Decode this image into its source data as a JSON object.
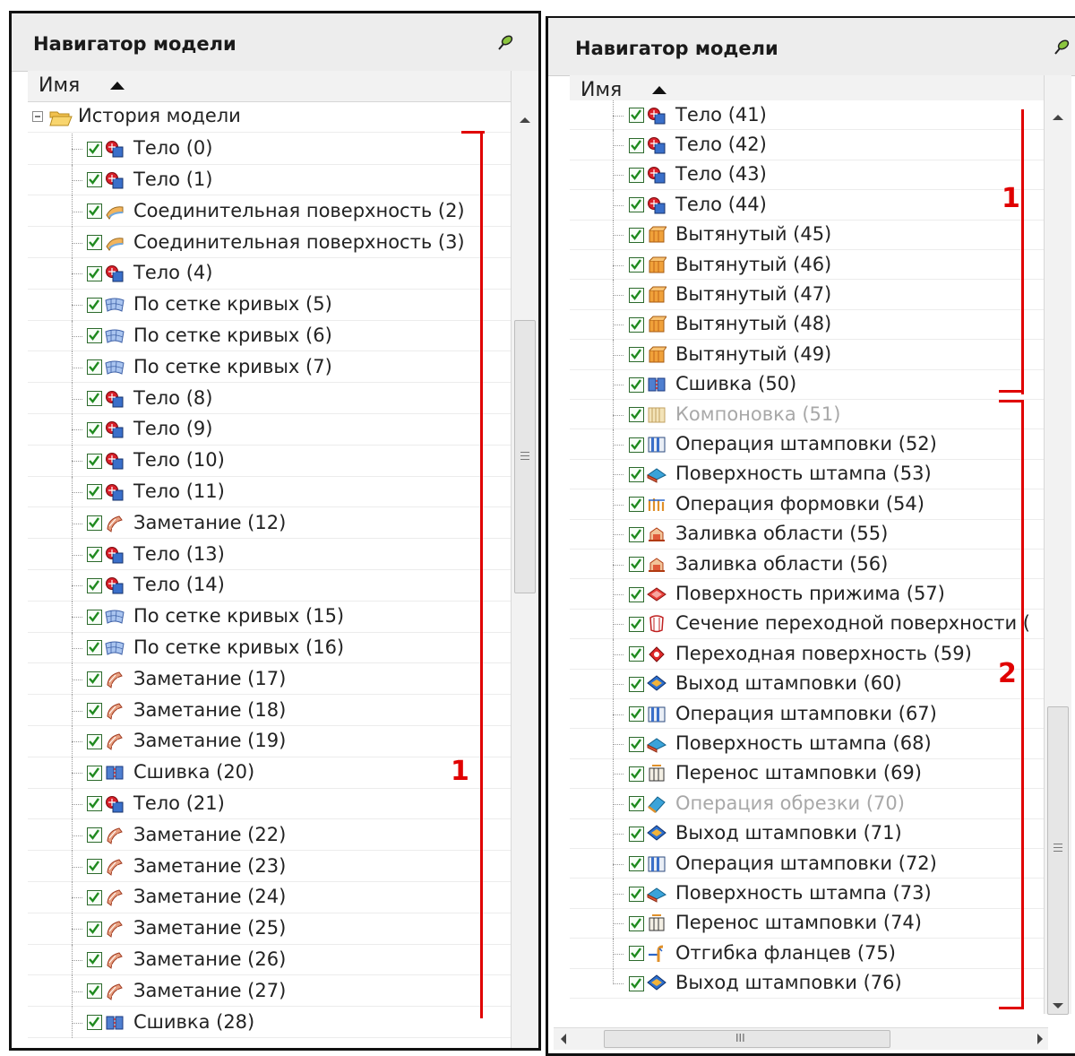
{
  "colors": {
    "annotation": "#e00000",
    "checkbox": "#2d6a2d"
  },
  "left": {
    "title": "Навигатор модели",
    "column_name": "Имя",
    "root_label": "История модели",
    "annotation": "1",
    "items": [
      {
        "label": "Тело (0)",
        "icon": "body-icon"
      },
      {
        "label": "Тело (1)",
        "icon": "body-icon"
      },
      {
        "label": "Соединительная поверхность (2)",
        "icon": "blend-surface-icon"
      },
      {
        "label": "Соединительная поверхность (3)",
        "icon": "blend-surface-icon"
      },
      {
        "label": "Тело (4)",
        "icon": "body-icon"
      },
      {
        "label": "По сетке кривых (5)",
        "icon": "curve-mesh-icon"
      },
      {
        "label": "По сетке кривых (6)",
        "icon": "curve-mesh-icon"
      },
      {
        "label": "По сетке кривых (7)",
        "icon": "curve-mesh-icon"
      },
      {
        "label": "Тело (8)",
        "icon": "body-icon"
      },
      {
        "label": "Тело (9)",
        "icon": "body-icon"
      },
      {
        "label": "Тело (10)",
        "icon": "body-icon"
      },
      {
        "label": "Тело (11)",
        "icon": "body-icon"
      },
      {
        "label": "Заметание (12)",
        "icon": "sweep-icon"
      },
      {
        "label": "Тело (13)",
        "icon": "body-icon"
      },
      {
        "label": "Тело (14)",
        "icon": "body-icon"
      },
      {
        "label": "По сетке кривых (15)",
        "icon": "curve-mesh-icon"
      },
      {
        "label": "По сетке кривых (16)",
        "icon": "curve-mesh-icon"
      },
      {
        "label": "Заметание (17)",
        "icon": "sweep-icon"
      },
      {
        "label": "Заметание (18)",
        "icon": "sweep-icon"
      },
      {
        "label": "Заметание (19)",
        "icon": "sweep-icon"
      },
      {
        "label": "Сшивка (20)",
        "icon": "sew-icon"
      },
      {
        "label": "Тело (21)",
        "icon": "body-icon"
      },
      {
        "label": "Заметание (22)",
        "icon": "sweep-icon"
      },
      {
        "label": "Заметание (23)",
        "icon": "sweep-icon"
      },
      {
        "label": "Заметание (24)",
        "icon": "sweep-icon"
      },
      {
        "label": "Заметание (25)",
        "icon": "sweep-icon"
      },
      {
        "label": "Заметание (26)",
        "icon": "sweep-icon"
      },
      {
        "label": "Заметание (27)",
        "icon": "sweep-icon"
      },
      {
        "label": "Сшивка (28)",
        "icon": "sew-icon"
      }
    ]
  },
  "right": {
    "title": "Навигатор модели",
    "column_name": "Имя",
    "annotation1": "1",
    "annotation2": "2",
    "hscroll_grip": "III",
    "items": [
      {
        "label": "Тело (41)",
        "icon": "body-icon"
      },
      {
        "label": "Тело (42)",
        "icon": "body-icon"
      },
      {
        "label": "Тело (43)",
        "icon": "body-icon"
      },
      {
        "label": "Тело (44)",
        "icon": "body-icon"
      },
      {
        "label": "Вытянутый (45)",
        "icon": "extrude-icon"
      },
      {
        "label": "Вытянутый (46)",
        "icon": "extrude-icon"
      },
      {
        "label": "Вытянутый (47)",
        "icon": "extrude-icon"
      },
      {
        "label": "Вытянутый (48)",
        "icon": "extrude-icon"
      },
      {
        "label": "Вытянутый (49)",
        "icon": "extrude-icon"
      },
      {
        "label": "Сшивка (50)",
        "icon": "sew-icon"
      },
      {
        "label": "Компоновка (51)",
        "icon": "layout-icon",
        "disabled": true
      },
      {
        "label": "Операция штамповки (52)",
        "icon": "stamp-operation-icon"
      },
      {
        "label": "Поверхность штампа (53)",
        "icon": "die-surface-icon"
      },
      {
        "label": "Операция формовки (54)",
        "icon": "forming-icon"
      },
      {
        "label": "Заливка области (55)",
        "icon": "fill-region-icon"
      },
      {
        "label": "Заливка области (56)",
        "icon": "fill-region-icon"
      },
      {
        "label": "Поверхность прижима (57)",
        "icon": "binder-surface-icon"
      },
      {
        "label": "Сечение переходной поверхности (",
        "icon": "transition-section-icon"
      },
      {
        "label": "Переходная поверхность (59)",
        "icon": "transition-surface-icon"
      },
      {
        "label": "Выход штамповки (60)",
        "icon": "stamp-exit-icon"
      },
      {
        "label": "Операция штамповки (67)",
        "icon": "stamp-operation-icon"
      },
      {
        "label": "Поверхность штампа (68)",
        "icon": "die-surface-icon"
      },
      {
        "label": "Перенос штамповки (69)",
        "icon": "stamp-transfer-icon"
      },
      {
        "label": "Операция обрезки (70)",
        "icon": "trim-icon",
        "disabled": true
      },
      {
        "label": "Выход штамповки (71)",
        "icon": "stamp-exit-icon"
      },
      {
        "label": "Операция штамповки (72)",
        "icon": "stamp-operation-icon"
      },
      {
        "label": "Поверхность штампа (73)",
        "icon": "die-surface-icon"
      },
      {
        "label": "Перенос штамповки (74)",
        "icon": "stamp-transfer-icon"
      },
      {
        "label": "Отгибка фланцев (75)",
        "icon": "flange-icon"
      },
      {
        "label": "Выход штамповки (76)",
        "icon": "stamp-exit-icon"
      }
    ]
  }
}
